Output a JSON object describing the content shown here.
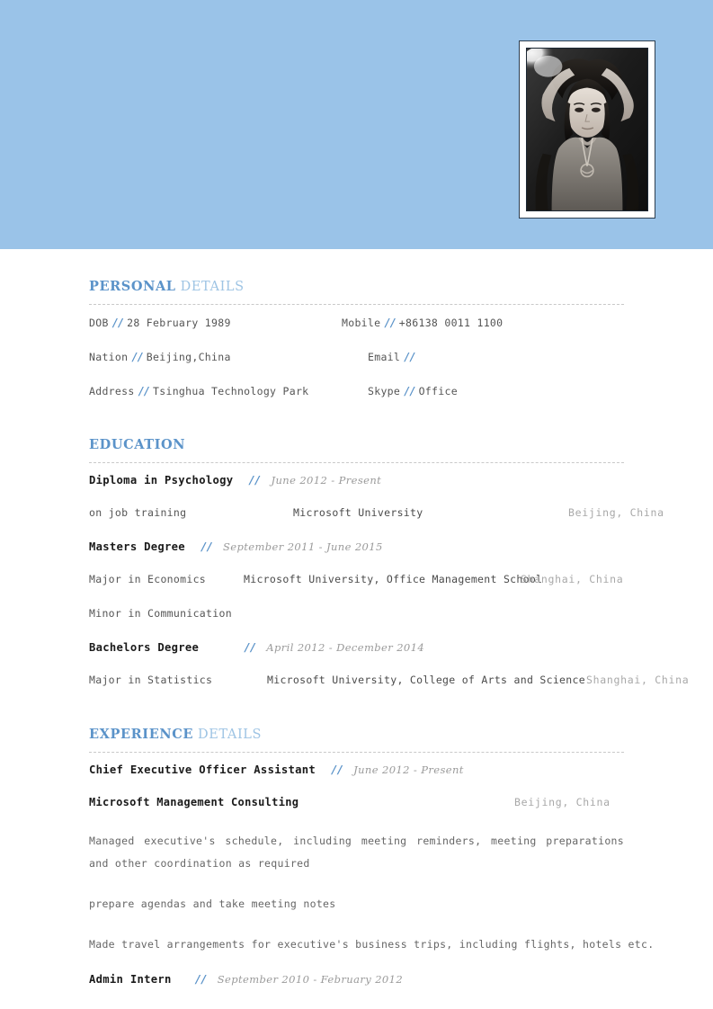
{
  "header": {
    "banner_color": "#9ac3e8",
    "photo_alt": "portrait-photo"
  },
  "sections": {
    "personal": {
      "title_primary": "PERSONAL",
      "title_secondary": "DETAILS",
      "rows": [
        {
          "left_label": "DOB",
          "left_sep": "//",
          "left_value": "28 February 1989",
          "right_label": "Mobile",
          "right_sep": "//",
          "right_value": "+86138 0011 1100"
        },
        {
          "left_label": "Nation",
          "left_sep": "//",
          "left_value": "Beijing,China",
          "right_label": "Email",
          "right_sep": "//",
          "right_value": ""
        },
        {
          "left_label": "Address",
          "left_sep": "//",
          "left_value": "Tsinghua Technology Park",
          "right_label": "Skype",
          "right_sep": "//",
          "right_value": "Office"
        }
      ]
    },
    "education": {
      "title_primary": "EDUCATION",
      "title_secondary": "",
      "entries": [
        {
          "title": "Diploma in Psychology",
          "sep": "//",
          "date": "June 2012 - Present",
          "details": [
            {
              "detail": "on job training",
              "org": "Microsoft University",
              "loc": "Beijing, China"
            }
          ]
        },
        {
          "title": "Masters Degree",
          "sep": "//",
          "date": "September 2011 - June 2015",
          "details": [
            {
              "detail": "Major in Economics",
              "org": "Microsoft University, Office Management School",
              "loc": "Shanghai, China"
            },
            {
              "detail": "Minor in Communication",
              "org": "",
              "loc": ""
            }
          ]
        },
        {
          "title": "Bachelors Degree",
          "sep": "//",
          "date": "April 2012 - December 2014",
          "details": [
            {
              "detail": "Major in Statistics",
              "org": "Microsoft University, College of Arts and Science",
              "loc": "Shanghai, China"
            }
          ]
        }
      ]
    },
    "experience": {
      "title_primary": "EXPERIENCE",
      "title_secondary": "DETAILS",
      "entries": [
        {
          "title": "Chief Executive Officer Assistant",
          "sep": "//",
          "date": "June 2012 - Present",
          "company": "Microsoft Management Consulting",
          "loc": "Beijing, China",
          "bullets": [
            "Managed executive's schedule, including meeting reminders, meeting preparations and other coordination as required",
            "prepare agendas and take meeting notes",
            "Made travel arrangements for executive's business trips, including flights, hotels etc."
          ]
        },
        {
          "title": "Admin Intern",
          "sep": "//",
          "date": "September 2010 - February 2012",
          "company": "",
          "loc": "",
          "bullets": []
        }
      ]
    }
  }
}
